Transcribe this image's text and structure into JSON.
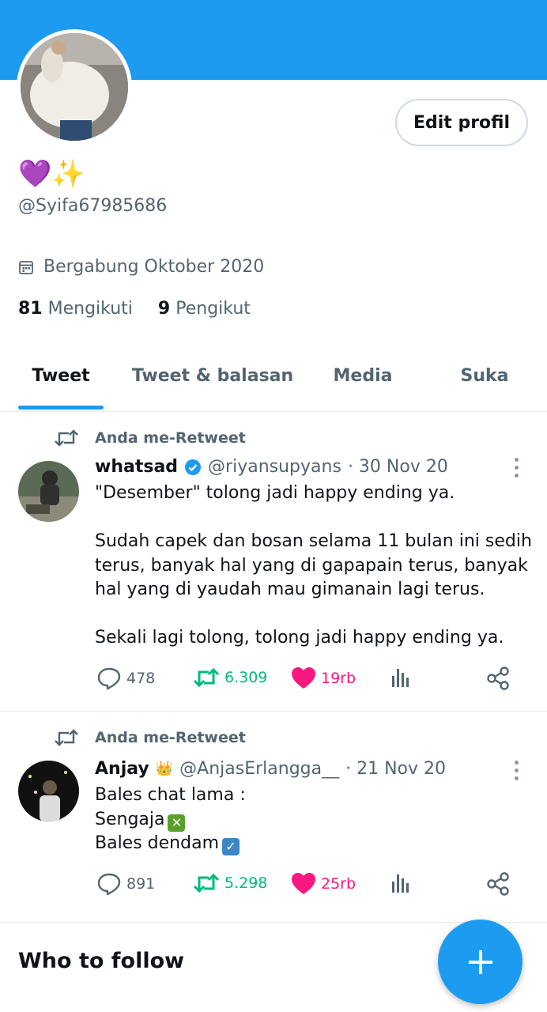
{
  "profile": {
    "display_name": "💜✨",
    "handle": "@Syifa67985686",
    "joined": "Bergabung Oktober 2020",
    "following_count": "81",
    "following_label": "Mengikuti",
    "followers_count": "9",
    "followers_label": "Pengikut",
    "edit_label": "Edit profil"
  },
  "tabs": [
    {
      "label": "Tweet",
      "active": true
    },
    {
      "label": "Tweet & balasan",
      "active": false
    },
    {
      "label": "Media",
      "active": false
    },
    {
      "label": "Suka",
      "active": false
    }
  ],
  "tweets": [
    {
      "retweet_label": "Anda me-Retweet",
      "name": "whatsad",
      "verified": true,
      "handle": "@riyansupyans",
      "date": "· 30 Nov 20",
      "body": "\"Desember\" tolong jadi happy ending ya.\n\nSudah capek dan bosan selama 11 bulan ini sedih terus, banyak hal yang di gapapain terus, banyak hal yang di yaudah mau gimanain lagi terus.\n\nSekali lagi tolong, tolong jadi happy ending ya.",
      "replies": "478",
      "retweets": "6.309",
      "likes": "19rb"
    },
    {
      "retweet_label": "Anda me-Retweet",
      "name": "Anjay",
      "name_emoji": "👑",
      "handle": "@AnjasErlangga__",
      "date": "· 21 Nov 20",
      "body_lines": [
        "Bales chat lama :",
        "Sengaja",
        "Bales dendam"
      ],
      "replies": "891",
      "retweets": "5.298",
      "likes": "25rb"
    }
  ],
  "who_to_follow": "Who to follow",
  "colors": {
    "accent": "#1d9bf0",
    "retweet": "#00ba7c",
    "like": "#f91880",
    "secondary_text": "#536471"
  }
}
